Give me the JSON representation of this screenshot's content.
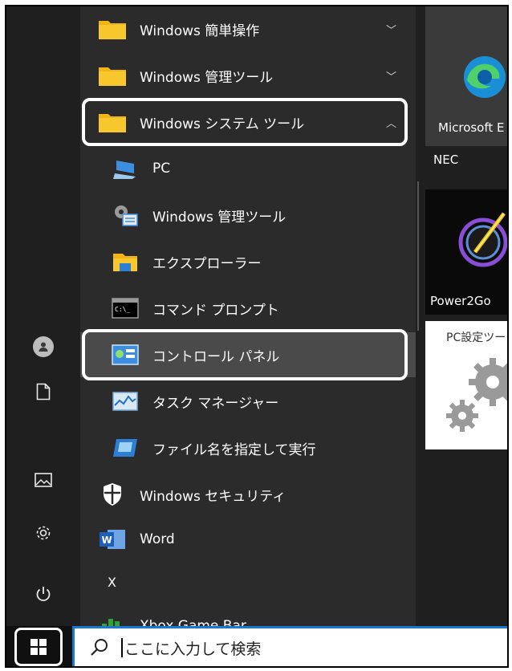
{
  "rail": {
    "icons": [
      "user-icon",
      "document-icon",
      "pictures-icon",
      "settings-icon",
      "power-icon"
    ]
  },
  "applist": {
    "rows": [
      {
        "label": "Windows 簡単操作",
        "icon": "folder-icon",
        "chevron": "﹀"
      },
      {
        "label": "Windows 管理ツール",
        "icon": "folder-icon",
        "chevron": "﹀"
      },
      {
        "label": "Windows システム ツール",
        "icon": "folder-icon",
        "chevron": "︿"
      },
      {
        "label": "PC",
        "icon": "pc-icon"
      },
      {
        "label": "Windows 管理ツール",
        "icon": "admin-tools-icon"
      },
      {
        "label": "エクスプローラー",
        "icon": "explorer-icon"
      },
      {
        "label": "コマンド プロンプト",
        "icon": "command-prompt-icon"
      },
      {
        "label": "コントロール パネル",
        "icon": "control-panel-icon"
      },
      {
        "label": "タスク マネージャー",
        "icon": "task-manager-icon"
      },
      {
        "label": "ファイル名を指定して実行",
        "icon": "run-icon"
      },
      {
        "label": "Windows セキュリティ",
        "icon": "shield-icon"
      },
      {
        "label": "Word",
        "icon": "word-icon"
      },
      {
        "label": "Xbox Game Bar",
        "icon": "xbox-icon"
      }
    ],
    "letter_x": "X"
  },
  "tiles": {
    "edge_label": "Microsoft E",
    "group_label": "NEC",
    "power2go_label": "Power2Go",
    "pcsettings_label": "PC設定ツー"
  },
  "taskbar": {
    "search_placeholder": "ここに入力して検索",
    "search_accent": "#1a78d4"
  }
}
